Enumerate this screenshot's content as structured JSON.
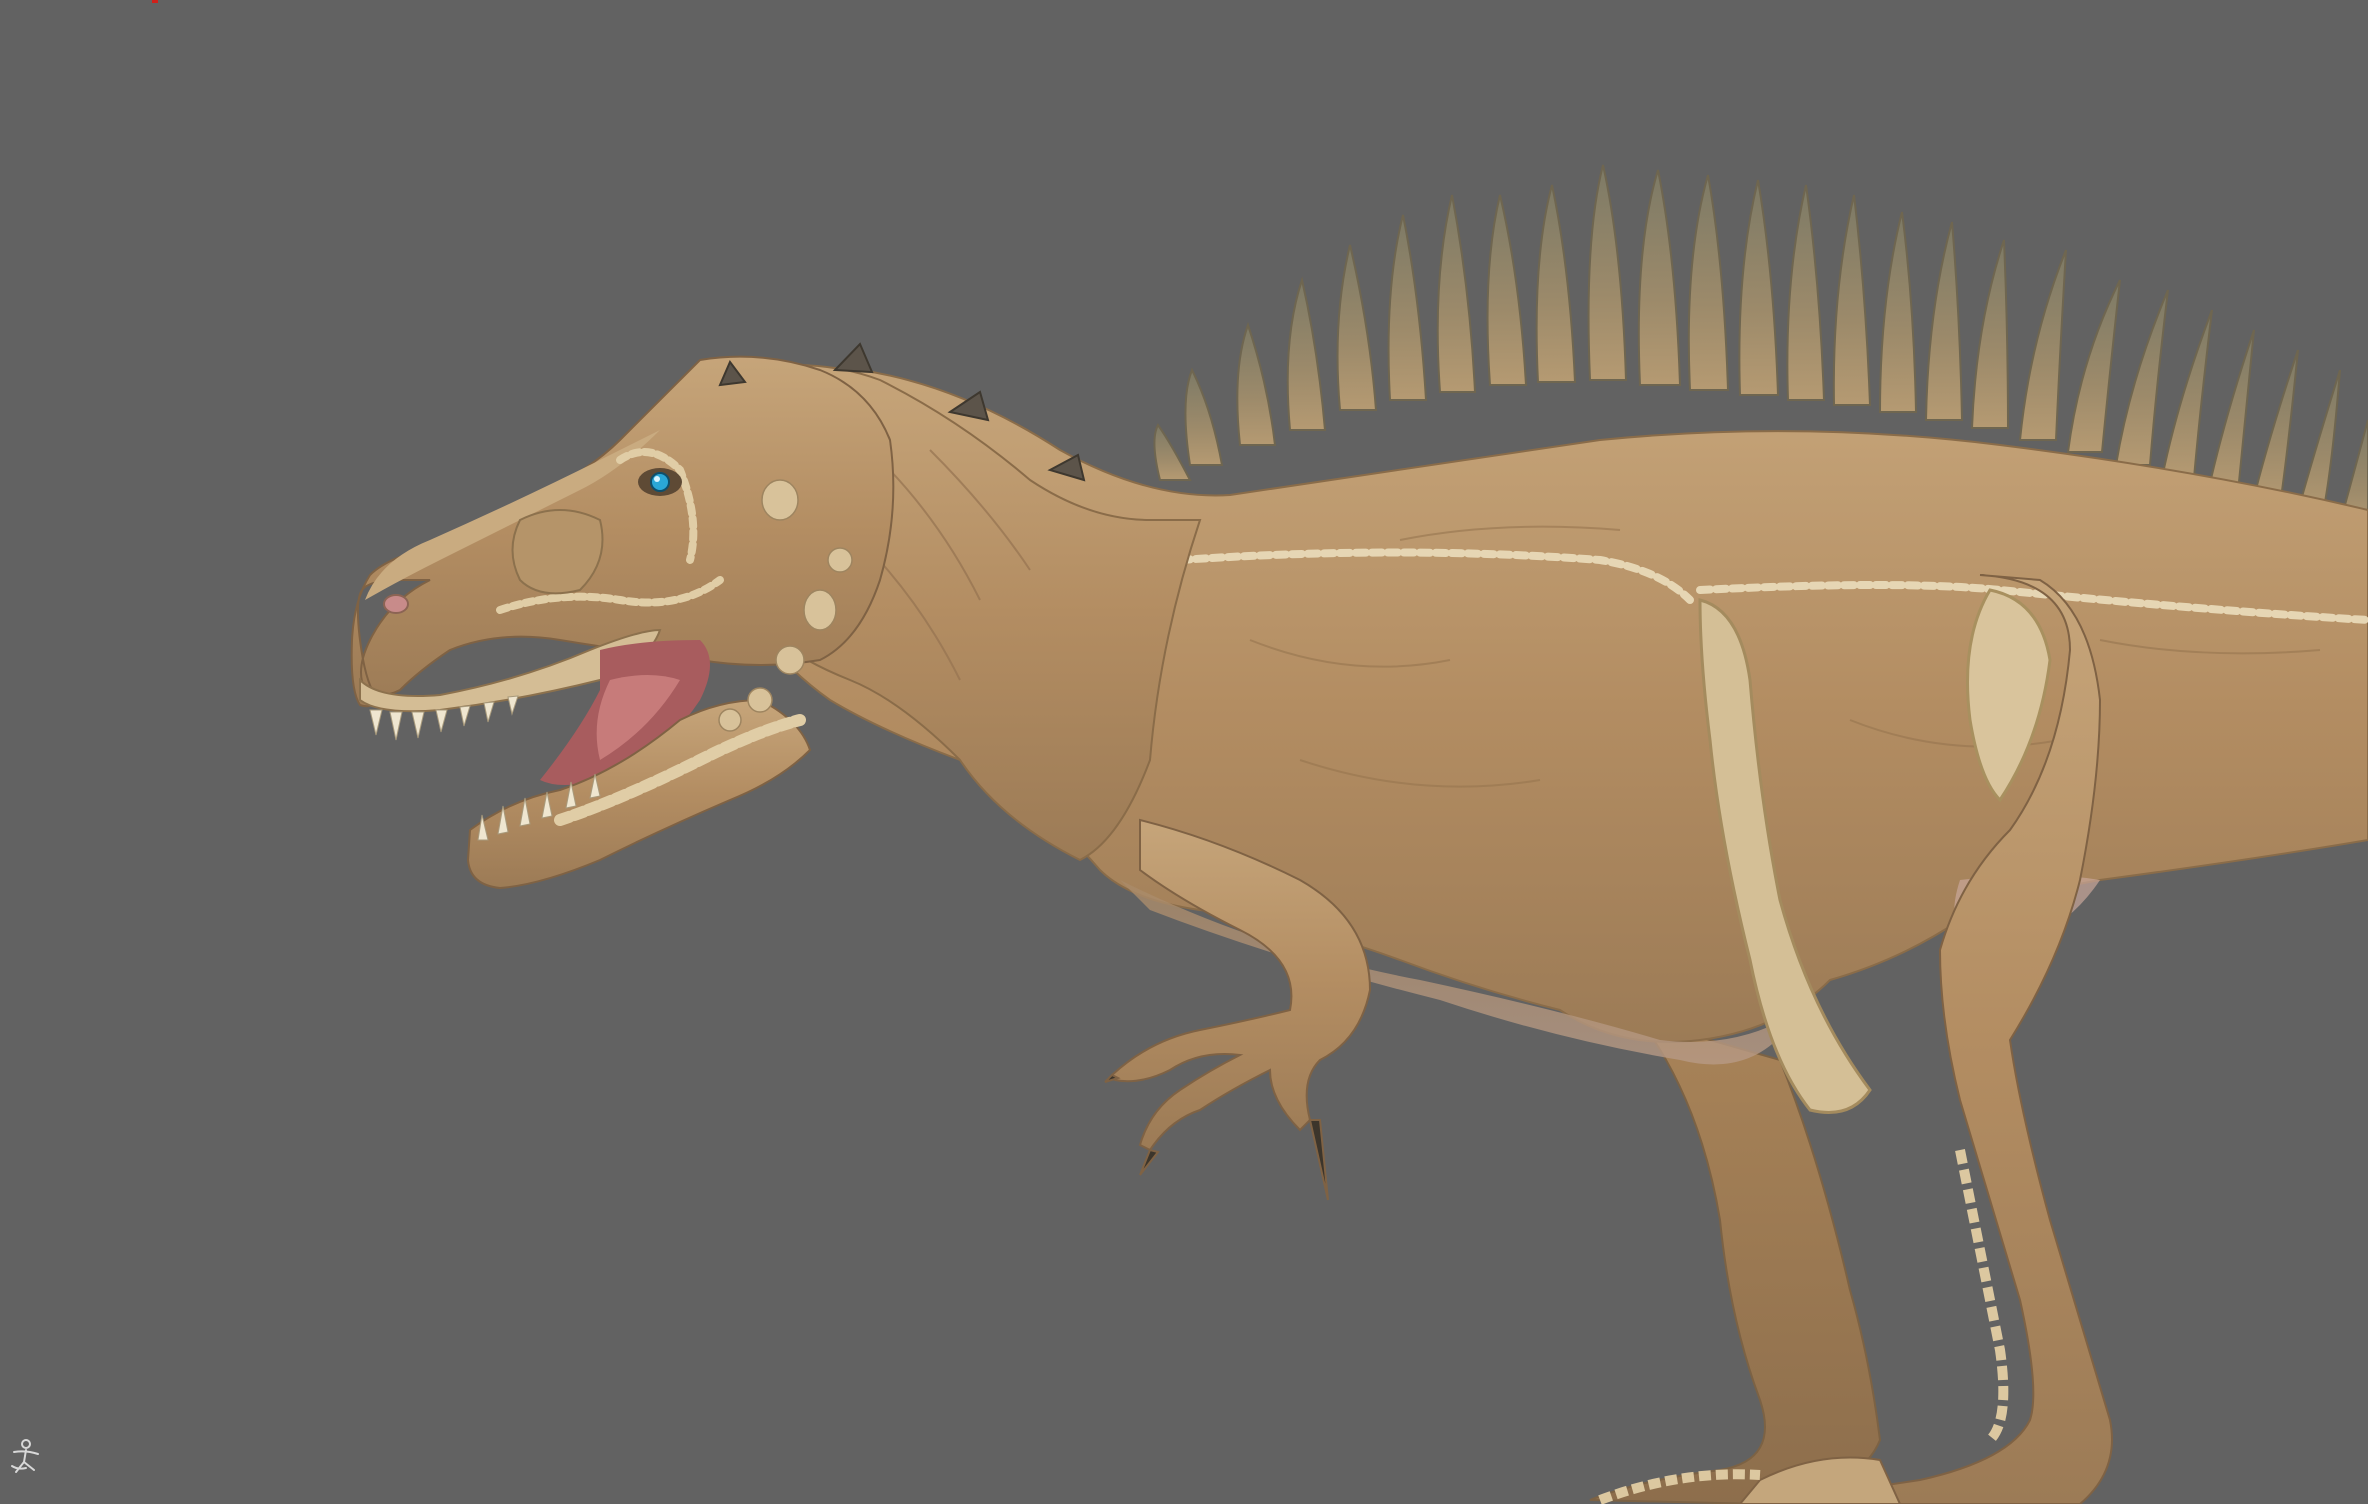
{
  "viewport": {
    "background_color": "#626262",
    "model_subject": "dinosaur-sculpt",
    "skin_color": "#b8966a",
    "eye_color": "#2aa7d6",
    "mouth_color": "#b86a6a"
  },
  "icons": {
    "corner_logo": "figure-logo-icon",
    "corner_marker": "red-marker"
  }
}
